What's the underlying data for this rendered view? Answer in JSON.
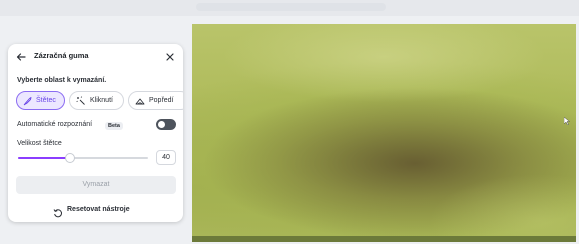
{
  "panel": {
    "title": "Zázračná guma",
    "subtitle": "Vyberte oblast k vymazání.",
    "tabs": [
      {
        "label": "Štětec",
        "icon": "brush-icon",
        "active": true
      },
      {
        "label": "Kliknutí",
        "icon": "magic-click-icon",
        "active": false
      },
      {
        "label": "Popředí",
        "icon": "foreground-icon",
        "active": false
      }
    ],
    "auto_detect_label": "Automatické rozpoznání",
    "beta_badge": "Beta",
    "auto_detect_on": false,
    "brush_size_label": "Velikost štětce",
    "brush_size_value": "40",
    "brush_size_fraction": 0.4,
    "erase_button": "Vymazat",
    "reset_label": "Resetovat nástroje"
  },
  "colors": {
    "accent": "#8b3dff",
    "active_tab_bg": "#ece7ff",
    "toggle_off": "#4d535c"
  }
}
